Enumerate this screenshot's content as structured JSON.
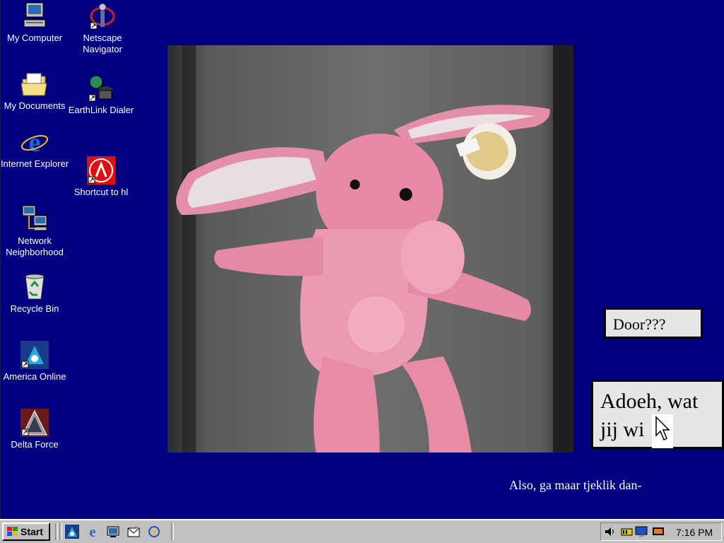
{
  "desktop_icons": [
    {
      "label": "My Computer",
      "icon": "computer-icon"
    },
    {
      "label": "Netscape Navigator",
      "icon": "netscape-icon"
    },
    {
      "label": "My Documents",
      "icon": "folder-icon"
    },
    {
      "label": "EarthLink Dialer",
      "icon": "dialer-icon"
    },
    {
      "label": "Internet Explorer",
      "icon": "ie-icon"
    },
    {
      "label": "Shortcut to hl",
      "icon": "halflife-icon"
    },
    {
      "label": "Network Neighborhood",
      "icon": "network-icon"
    },
    {
      "label": "Recycle Bin",
      "icon": "recycle-bin-icon"
    },
    {
      "label": "America Online",
      "icon": "aol-icon"
    },
    {
      "label": "Delta Force",
      "icon": "delta-force-icon"
    }
  ],
  "boxes": {
    "door": "Door???",
    "adoeh_line1": "Adoeh, wat",
    "adoeh_line2": "jij wi"
  },
  "caption": "Also, ga maar tjeklik dan-",
  "taskbar": {
    "start_label": "Start",
    "clock": "7:16 PM"
  },
  "colors": {
    "desktop": "#000080",
    "taskbar": "#c0c0c0"
  }
}
